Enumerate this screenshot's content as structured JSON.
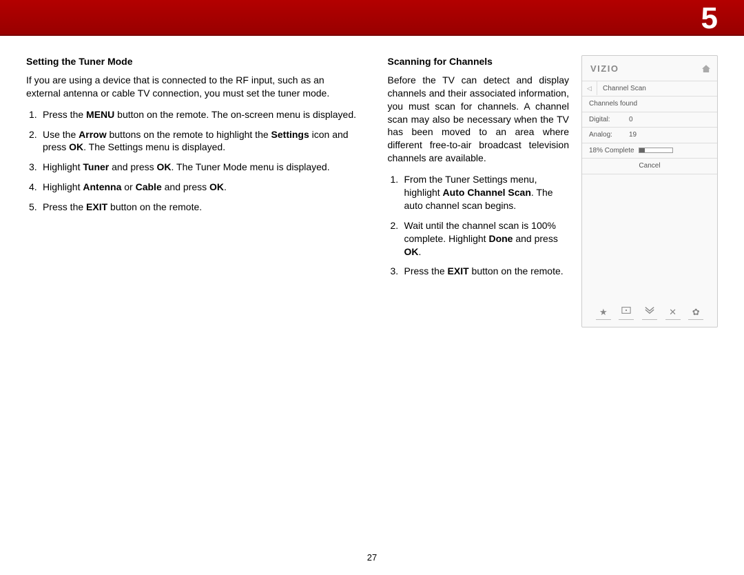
{
  "chapter": "5",
  "pageNumber": "27",
  "left": {
    "heading": "Setting the Tuner Mode",
    "intro": "If you are using a device that is connected to the RF input, such as an external antenna or cable TV connection, you must set the tuner mode.",
    "steps": [
      {
        "pre": "Press the ",
        "b1": "MENU",
        "mid": " button on the remote. The on-screen menu is displayed.",
        "b2": "",
        "post": ""
      },
      {
        "pre": "Use the ",
        "b1": "Arrow",
        "mid": " buttons on the remote to highlight the ",
        "b2": "Settings",
        "post_mid": " icon and press ",
        "b3": "OK",
        "post": ". The Settings menu is displayed."
      },
      {
        "pre": "Highlight ",
        "b1": "Tuner",
        "mid": " and press ",
        "b2": "OK",
        "post": ". The Tuner Mode menu is displayed."
      },
      {
        "pre": "Highlight ",
        "b1": "Antenna",
        "mid": " or ",
        "b2": "Cable",
        "post_mid": " and press ",
        "b3": "OK",
        "post": "."
      },
      {
        "pre": "Press the ",
        "b1": "EXIT",
        "mid": " button on the remote.",
        "b2": "",
        "post": ""
      }
    ]
  },
  "right": {
    "heading": "Scanning for Channels",
    "intro": "Before the TV can detect and display channels and their associated information, you must scan for channels. A channel scan may also be necessary when the TV has been moved to an area where different free-to-air broadcast television channels are available.",
    "steps": [
      {
        "pre": "From the Tuner Settings menu, highlight ",
        "b1": "Auto Channel Scan",
        "mid": ". The auto channel scan begins.",
        "b2": "",
        "post": ""
      },
      {
        "pre": "Wait until the channel scan is 100% complete. Highlight ",
        "b1": "Done",
        "mid": " and press ",
        "b2": "OK",
        "post": "."
      },
      {
        "pre": "Press the ",
        "b1": "EXIT",
        "mid": " button on the remote.",
        "b2": "",
        "post": ""
      }
    ]
  },
  "osd": {
    "logo": "VIZIO",
    "title": "Channel Scan",
    "found": "Channels found",
    "digitalLabel": "Digital:",
    "digitalValue": "0",
    "analogLabel": "Analog:",
    "analogValue": "19",
    "progressText": "18% Complete",
    "progressPct": 18,
    "cancel": "Cancel"
  }
}
